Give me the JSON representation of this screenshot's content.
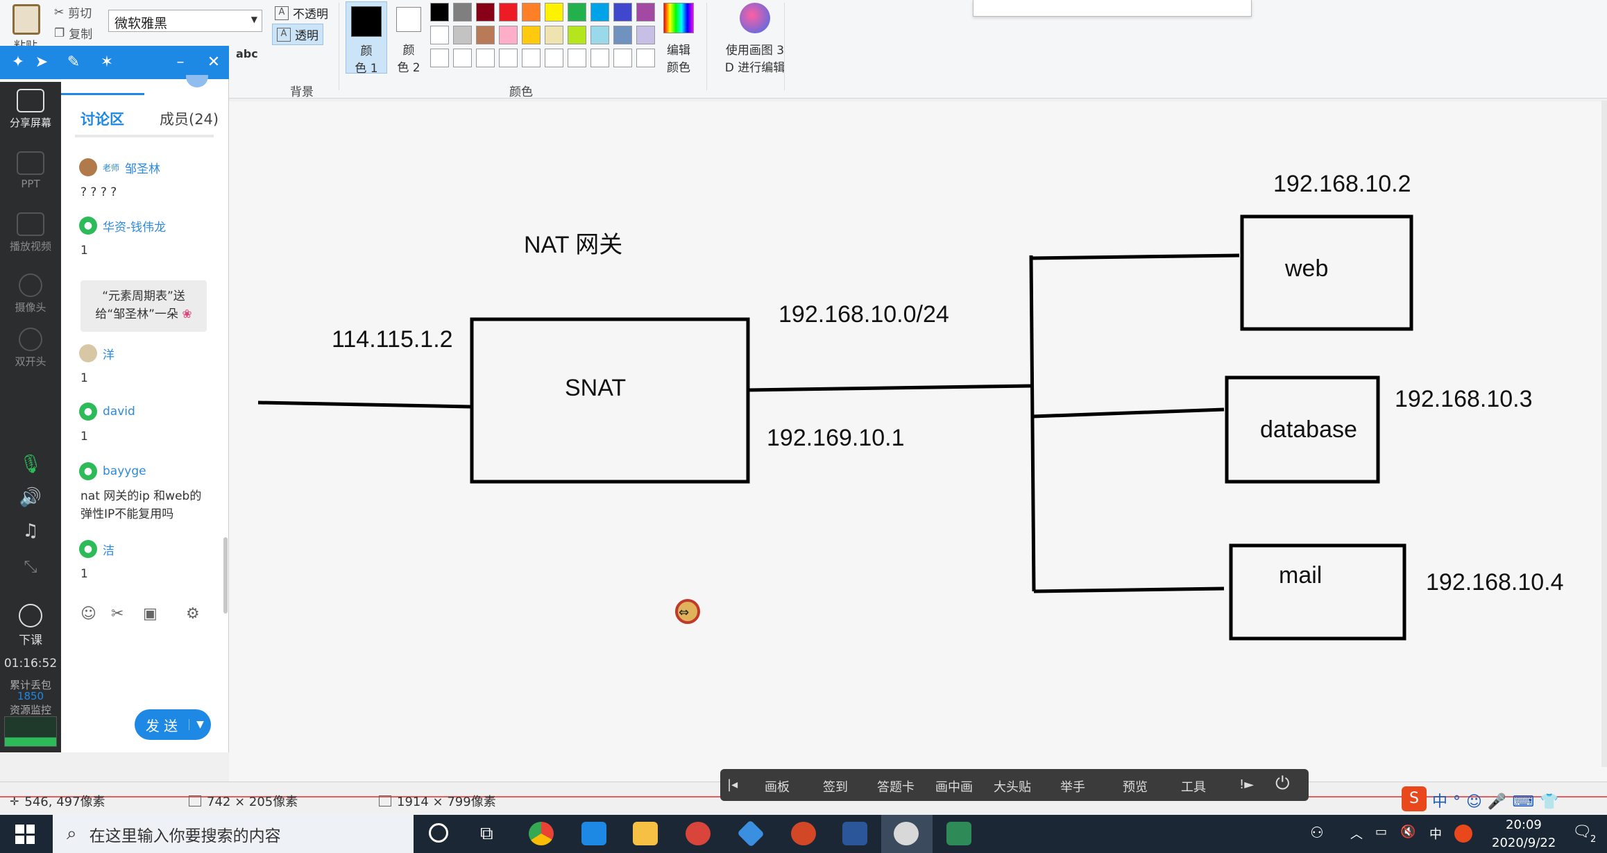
{
  "ribbon": {
    "cut_label": "剪切",
    "copy_label": "复制",
    "paste_label": "粘贴",
    "font_name": "微软雅黑",
    "opaque_label": "不透明",
    "transparent_label": "透明",
    "background_group": "背景",
    "color1_label_a": "颜",
    "color1_label_b": "色 1",
    "color2_label_a": "颜",
    "color2_label_b": "色 2",
    "colors_group": "颜色",
    "edit_colors_a": "编辑",
    "edit_colors_b": "颜色",
    "paint3d_a": "使用画图 3",
    "paint3d_b": "D 进行编辑",
    "text_tool_glyph": "abc",
    "palette_row1": [
      "#000000",
      "#7f7f7f",
      "#880015",
      "#ed1c24",
      "#ff7f27",
      "#fff200",
      "#22b14c",
      "#00a2e8",
      "#3f48cc",
      "#a349a4"
    ],
    "palette_row2": [
      "#ffffff",
      "#c3c3c3",
      "#b97a57",
      "#ffaec9",
      "#ffc90e",
      "#efe4b0",
      "#b5e61d",
      "#99d9ea",
      "#7092be",
      "#c8bfe7"
    ],
    "palette_row3": [
      "#ffffff",
      "#ffffff",
      "#ffffff",
      "#ffffff",
      "#ffffff",
      "#ffffff",
      "#ffffff",
      "#ffffff",
      "#ffffff",
      "#ffffff"
    ]
  },
  "side_toolbar": {
    "share_screen": "分享屏幕",
    "ppt": "PPT",
    "play_video": "播放视频",
    "camera": "摄像头",
    "multi_camera": "双开头",
    "end_class": "下课",
    "timer": "01:16:52",
    "packet_loss_label": "累计丢包",
    "packet_loss_value": "1850",
    "resource_monitor": "资源监控"
  },
  "chat": {
    "tab_discussion": "讨论区",
    "tab_members": "成员(24)",
    "messages": [
      {
        "badge": "老师",
        "name": "邹圣林",
        "text": "? ? ? ?"
      },
      {
        "name": "华资-钱伟龙",
        "text": "1"
      },
      {
        "name": "洋",
        "text": "1"
      },
      {
        "name": "david",
        "text": "1"
      },
      {
        "name": "bayyge",
        "text": "nat 网关的ip 和web的",
        "text2": "弹性IP不能复用吗"
      },
      {
        "name": "洁",
        "text": "1"
      }
    ],
    "gift_line1": "“元素周期表”送",
    "gift_line2": "给“邹圣林”一朵",
    "send_label": "发 送"
  },
  "diagram": {
    "title": "NAT 网关",
    "public_ip": "114.115.1.2",
    "gateway_label": "SNAT",
    "subnet": "192.168.10.0/24",
    "gateway_ip": "192.169.10.1",
    "nodes": [
      {
        "label": "web",
        "ip": "192.168.10.2"
      },
      {
        "label": "database",
        "ip": "192.168.10.3"
      },
      {
        "label": "mail",
        "ip": "192.168.10.4"
      }
    ]
  },
  "statusbar": {
    "cursor_pos": "546, 497像素",
    "selection_size": "742 × 205像素",
    "image_size": "1914 × 799像素"
  },
  "classbar": {
    "items": [
      "画板",
      "签到",
      "答题卡",
      "画中画",
      "大头贴",
      "举手",
      "预览",
      "工具"
    ]
  },
  "taskbar": {
    "search_placeholder": "在这里输入你要搜索的内容",
    "time": "20:09",
    "date": "2020/9/22",
    "ime": "中",
    "notification_count": "2"
  }
}
